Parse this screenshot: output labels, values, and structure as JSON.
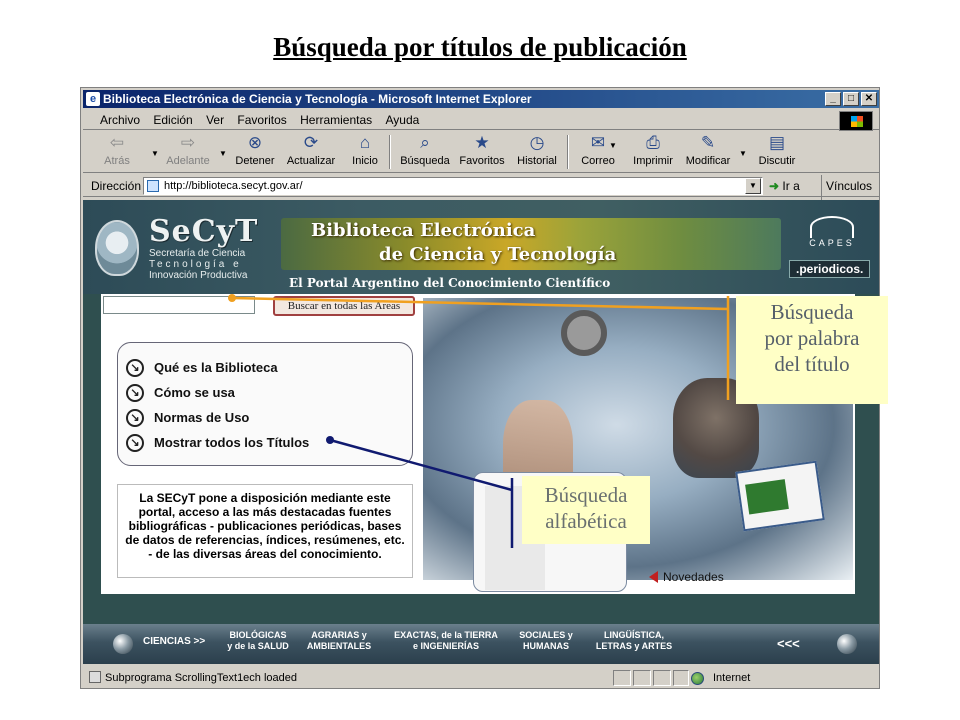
{
  "slide_title": "Búsqueda por títulos de publicación",
  "window": {
    "title": "Biblioteca Electrónica de Ciencia y Tecnología - Microsoft Internet Explorer",
    "controls": {
      "minimize": "_",
      "maximize": "□",
      "close": "✕"
    }
  },
  "menu": [
    "Archivo",
    "Edición",
    "Ver",
    "Favoritos",
    "Herramientas",
    "Ayuda"
  ],
  "toolbar": {
    "back": "Atrás",
    "forward": "Adelante",
    "stop": "Detener",
    "refresh": "Actualizar",
    "home": "Inicio",
    "search": "Búsqueda",
    "favorites": "Favoritos",
    "history": "Historial",
    "mail": "Correo",
    "print": "Imprimir",
    "edit": "Modificar",
    "discuss": "Discutir"
  },
  "address": {
    "label": "Dirección",
    "url": "http://biblioteca.secyt.gov.ar/",
    "go": "Ir a",
    "links": "Vínculos"
  },
  "site": {
    "logo": "SeCyT",
    "subtitle_lines": [
      "Secretaría de Ciencia",
      "Tecnología e",
      "Innovación Productiva"
    ],
    "banner_line1": "Biblioteca Electrónica",
    "banner_line2": "de Ciencia y Tecnología",
    "banner_sub": "El Portal Argentino del Conocimiento Científico",
    "capes": "CAPES",
    "periodicos": ".periodicos.",
    "search_button": "Buscar en todas las Areas",
    "nav_items": [
      "Qué es la Biblioteca",
      "Cómo se usa",
      "Normas de Uso",
      "Mostrar todos los Títulos"
    ],
    "info_text": "La SECyT pone a disposición mediante este portal, acceso a las más destacadas fuentes bibliográficas - publicaciones periódicas, bases de datos de referencias, índices, resúmenes, etc. - de las diversas áreas del conocimiento.",
    "novedades": "Novedades",
    "bottom_nav": {
      "ciencias": "CIENCIAS >>",
      "biologicas": [
        "BIOLÓGICAS",
        "y de la SALUD"
      ],
      "agrarias": [
        "AGRARIAS y",
        "AMBIENTALES"
      ],
      "exactas": [
        "EXACTAS, de la TIERRA",
        "e INGENIERÍAS"
      ],
      "sociales": [
        "SOCIALES y",
        "HUMANAS"
      ],
      "linguistica": [
        "LINGÜÍSTICA,",
        "LETRAS y ARTES"
      ],
      "back": "<<<"
    }
  },
  "status": {
    "text": "Subprograma ScrollingText1ech loaded",
    "zone": "Internet"
  },
  "callouts": {
    "palabra": [
      "Búsqueda",
      "por palabra",
      "del título"
    ],
    "alfabetica": [
      "Búsqueda",
      "alfabética"
    ]
  },
  "colors": {
    "title_bar": "#0a246a",
    "callout_bg": "#ffffc6",
    "callout_line_orange": "#f0a020",
    "callout_line_navy": "#101a70"
  }
}
